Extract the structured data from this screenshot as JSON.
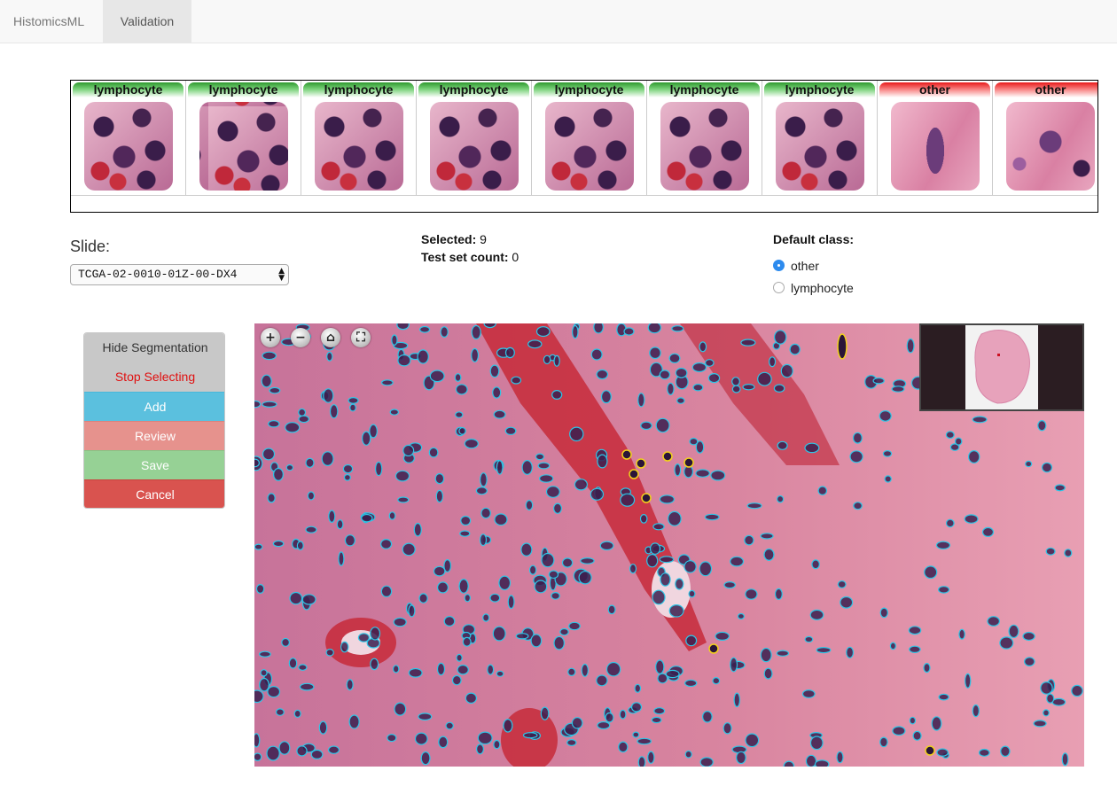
{
  "nav": {
    "brand": "HistomicsML",
    "tab": "Validation"
  },
  "samples": [
    {
      "label": "lymphocyte",
      "status": "green"
    },
    {
      "label": "lymphocyte",
      "status": "green"
    },
    {
      "label": "lymphocyte",
      "status": "green"
    },
    {
      "label": "lymphocyte",
      "status": "green"
    },
    {
      "label": "lymphocyte",
      "status": "green"
    },
    {
      "label": "lymphocyte",
      "status": "green"
    },
    {
      "label": "lymphocyte",
      "status": "green"
    },
    {
      "label": "other",
      "status": "red"
    },
    {
      "label": "other",
      "status": "red"
    }
  ],
  "slide": {
    "label": "Slide:",
    "selected": "TCGA-02-0010-01Z-00-DX4"
  },
  "stats": {
    "selected_label": "Selected:",
    "selected_value": "9",
    "test_label": "Test set count:",
    "test_value": "0"
  },
  "default_class": {
    "label": "Default class:",
    "options": [
      "other",
      "lymphocyte"
    ],
    "checked": "other"
  },
  "buttons": {
    "hide_segmentation": "Hide Segmentation",
    "stop_selecting": "Stop Selecting",
    "add": "Add",
    "review": "Review",
    "save": "Save",
    "cancel": "Cancel"
  },
  "viewer_controls": {
    "zoom_in": "+",
    "zoom_out": "−",
    "home": "⌂",
    "fullscreen": "⛶"
  },
  "colors": {
    "segmentation_outline": "#2ec5e6",
    "selected_outline": "#f2d21b",
    "positive_label": "#2f9a2f",
    "negative_label": "#e81b1b",
    "add_button": "#5bc0de",
    "review_button": "#e6928d",
    "save_button": "#96d195",
    "cancel_button": "#d9534f"
  }
}
